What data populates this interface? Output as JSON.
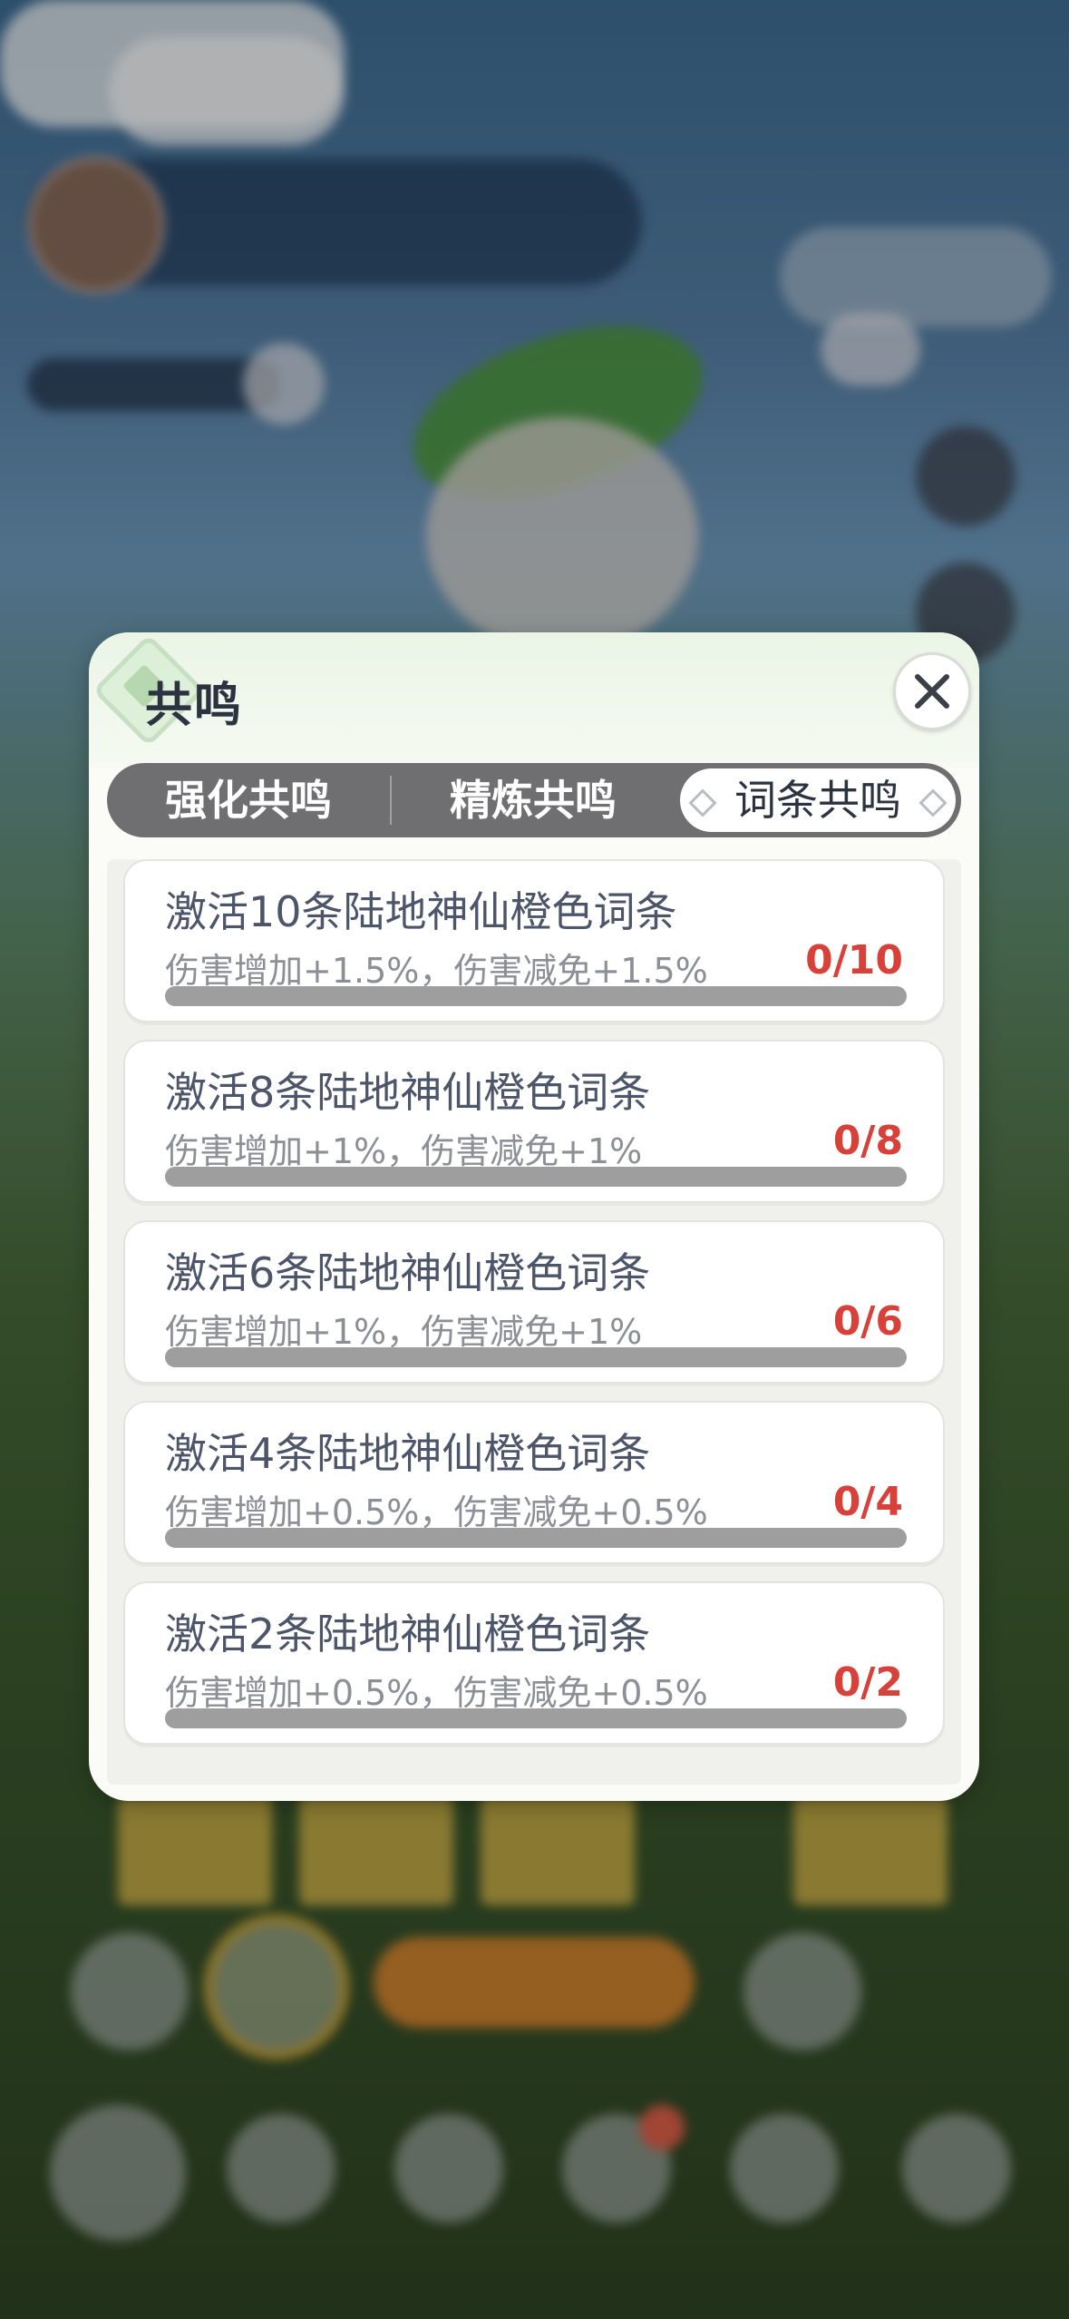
{
  "dialog": {
    "title": "共鸣",
    "tabs": [
      {
        "label": "强化共鸣",
        "active": false
      },
      {
        "label": "精炼共鸣",
        "active": false
      },
      {
        "label": "词条共鸣",
        "active": true
      }
    ],
    "items": [
      {
        "title": "激活10条陆地神仙橙色词条",
        "desc": "伤害增加+1.5%，伤害减免+1.5%",
        "count": "0/10",
        "progress": 0
      },
      {
        "title": "激活8条陆地神仙橙色词条",
        "desc": "伤害增加+1%，伤害减免+1%",
        "count": "0/8",
        "progress": 0
      },
      {
        "title": "激活6条陆地神仙橙色词条",
        "desc": "伤害增加+1%，伤害减免+1%",
        "count": "0/6",
        "progress": 0
      },
      {
        "title": "激活4条陆地神仙橙色词条",
        "desc": "伤害增加+0.5%，伤害减免+0.5%",
        "count": "0/4",
        "progress": 0
      },
      {
        "title": "激活2条陆地神仙橙色词条",
        "desc": "伤害增加+0.5%，伤害减免+0.5%",
        "count": "0/2",
        "progress": 0
      }
    ]
  },
  "icons": {
    "close": "close-icon",
    "title_emblem": "diamond-emblem-icon"
  },
  "colors": {
    "count_red": "#d8403a",
    "tab_bar": "#6f6f72",
    "progress_track": "#9e9e9e"
  }
}
